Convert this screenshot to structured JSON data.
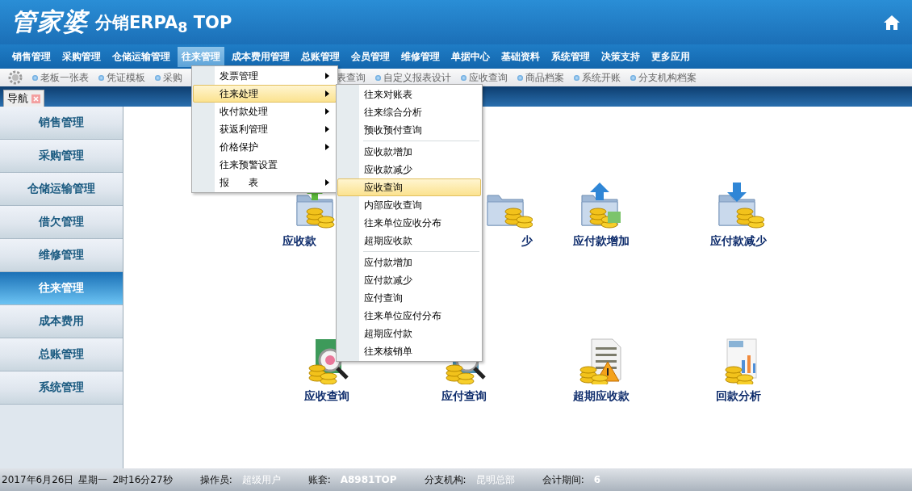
{
  "header": {
    "logo_main": "管家婆",
    "logo_sub": "分销ERPA$_{8}$ TOP"
  },
  "menu_bar": [
    {
      "label": "销售管理",
      "selected": false
    },
    {
      "label": "采购管理",
      "selected": false
    },
    {
      "label": "仓储运输管理",
      "selected": false
    },
    {
      "label": "往来管理",
      "selected": true
    },
    {
      "label": "成本费用管理",
      "selected": false
    },
    {
      "label": "总账管理",
      "selected": false
    },
    {
      "label": "会员管理",
      "selected": false
    },
    {
      "label": "维修管理",
      "selected": false
    },
    {
      "label": "单据中心",
      "selected": false
    },
    {
      "label": "基础资料",
      "selected": false
    },
    {
      "label": "系统管理",
      "selected": false
    },
    {
      "label": "决策支持",
      "selected": false
    },
    {
      "label": "更多应用",
      "selected": false
    }
  ],
  "quick_links": {
    "before_menu": [
      "老板一张表",
      "凭证模板",
      "采购"
    ],
    "after_menu": [
      "表查询",
      "自定义报表设计",
      "应收查询",
      "商品档案",
      "系统开账",
      "分支机构档案"
    ]
  },
  "tabs": [
    {
      "label": "导航",
      "selected": true
    }
  ],
  "sidebar": [
    {
      "label": "销售管理",
      "selected": false
    },
    {
      "label": "采购管理",
      "selected": false
    },
    {
      "label": "仓储运输管理",
      "selected": false
    },
    {
      "label": "借欠管理",
      "selected": false
    },
    {
      "label": "维修管理",
      "selected": false
    },
    {
      "label": "往来管理",
      "selected": true
    },
    {
      "label": "成本费用",
      "selected": false
    },
    {
      "label": "总账管理",
      "selected": false
    },
    {
      "label": "系统管理",
      "selected": false
    }
  ],
  "tiles": [
    {
      "label": "应收款",
      "kind": "cut-end"
    },
    {
      "label": "少",
      "kind": "cut-start"
    },
    {
      "label": "应付款增加",
      "kind": "full"
    },
    {
      "label": "应付款减少",
      "kind": "full"
    },
    {
      "label": "应收查询",
      "kind": "full"
    },
    {
      "label": "应付查询",
      "kind": "full"
    },
    {
      "label": "超期应收款",
      "kind": "full"
    },
    {
      "label": "回款分析",
      "kind": "full"
    }
  ],
  "dropdown": [
    {
      "label": "发票管理",
      "has_submenu": true,
      "selected": false
    },
    {
      "label": "往来处理",
      "has_submenu": true,
      "selected": true
    },
    {
      "label": "收付款处理",
      "has_submenu": true,
      "selected": false
    },
    {
      "label": "获返利管理",
      "has_submenu": true,
      "selected": false
    },
    {
      "label": "价格保护",
      "has_submenu": true,
      "selected": false
    },
    {
      "label": "往来预警设置",
      "has_submenu": false,
      "selected": false
    },
    {
      "label": "报　　表",
      "has_submenu": true,
      "selected": false
    }
  ],
  "submenu": [
    [
      {
        "label": "往来对账表",
        "selected": false
      },
      {
        "label": "往来综合分析",
        "selected": false
      },
      {
        "label": "预收预付查询",
        "selected": false
      }
    ],
    [
      {
        "label": "应收款增加",
        "selected": false
      },
      {
        "label": "应收款减少",
        "selected": false
      },
      {
        "label": "应收查询",
        "selected": true
      },
      {
        "label": "内部应收查询",
        "selected": false
      },
      {
        "label": "往来单位应收分布",
        "selected": false
      },
      {
        "label": "超期应收款",
        "selected": false
      }
    ],
    [
      {
        "label": "应付款增加",
        "selected": false
      },
      {
        "label": "应付款减少",
        "selected": false
      },
      {
        "label": "应付查询",
        "selected": false
      },
      {
        "label": "往来单位应付分布",
        "selected": false
      },
      {
        "label": "超期应付款",
        "selected": false
      },
      {
        "label": "往来核销单",
        "selected": false
      }
    ]
  ],
  "status_bar": {
    "date": "2017年6月26日",
    "weekday": "星期一",
    "time": "2时16分27秒",
    "fields": [
      {
        "label": "操作员:",
        "value": "超级用户"
      },
      {
        "label": "账套:",
        "value": "A8981TOP"
      },
      {
        "label": "分支机构:",
        "value": "昆明总部"
      },
      {
        "label": "会计期间:",
        "value": "6"
      }
    ]
  }
}
